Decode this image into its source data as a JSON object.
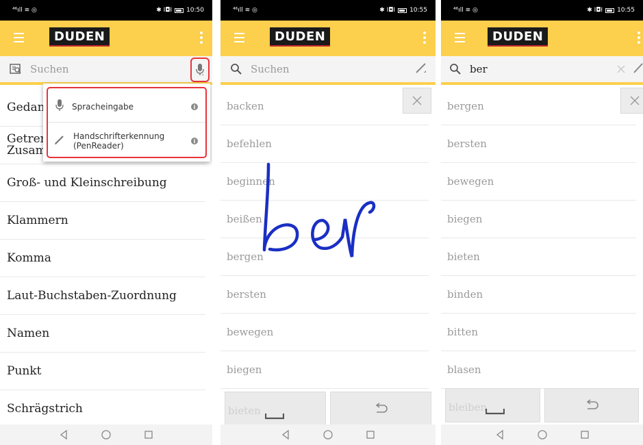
{
  "screens": [
    {
      "status": {
        "signal": "⁴⁶ıll ≋ ◎",
        "right_icons": "✱ I◘I",
        "time": "10:50"
      },
      "app_logo": "DUDEN",
      "search": {
        "placeholder": "Suchen",
        "value": ""
      },
      "list": [
        "Gedankenstrich",
        "Getrennt- und Zusammenschreibung",
        "Groß- und Kleinschreibung",
        "Klammern",
        "Komma",
        "Laut-Buchstaben-Zuordnung",
        "Namen",
        "Punkt",
        "Schrägstrich"
      ],
      "list_visible": [
        "Gedan",
        "Getren",
        "Zusam",
        "Groß- und Kleinschreibung",
        "Klammern",
        "Komma",
        "Laut-Buchstaben-Zuordnung",
        "Namen",
        "Punkt",
        "Schrägstrich"
      ],
      "popup": {
        "items": [
          {
            "label": "Spracheingabe",
            "icon": "mic-icon"
          },
          {
            "label": "Handschrifterkennung\n(PenReader)",
            "label_line1": "Handschrifterkennung",
            "label_line2": "(PenReader)",
            "icon": "pencil-icon"
          }
        ]
      }
    },
    {
      "status": {
        "signal": "⁴⁶ıll ≋ ◎",
        "right_icons": "✱ I◘I",
        "time": "10:55"
      },
      "app_logo": "DUDEN",
      "search": {
        "placeholder": "Suchen",
        "value": ""
      },
      "list": [
        "backen",
        "befehlen",
        "beginnen",
        "beißen",
        "bergen",
        "bersten",
        "bewegen",
        "biegen"
      ],
      "handwriting": "ber",
      "keyboard": {
        "ghost_word": "bieten",
        "space_icon": "space-icon",
        "undo_icon": "undo-icon"
      }
    },
    {
      "status": {
        "signal": "⁴⁶ıll ≋ ◎",
        "right_icons": "✱ I◘I",
        "time": "10:55"
      },
      "app_logo": "DUDEN",
      "search": {
        "placeholder": "Suchen",
        "value": "ber"
      },
      "list": [
        "bergen",
        "bersten",
        "bewegen",
        "biegen",
        "bieten",
        "binden",
        "bitten",
        "blasen"
      ],
      "keyboard": {
        "ghost_word": "bleiben",
        "space_icon": "space-icon",
        "undo_icon": "undo-icon"
      }
    }
  ],
  "colors": {
    "appbar": "#fccf4c",
    "highlight": "#e8343a",
    "ink": "#1a2fc4"
  }
}
